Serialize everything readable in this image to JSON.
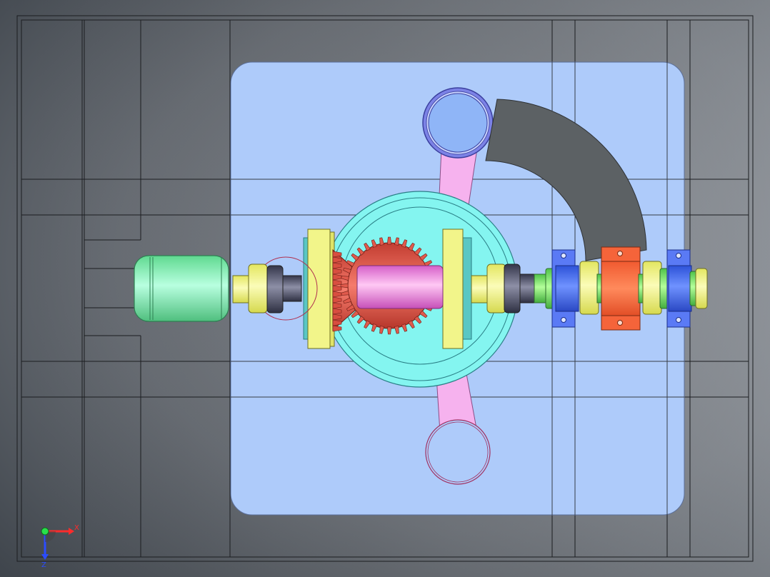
{
  "viewport": {
    "background_colors": [
      "#3f454d",
      "#8b9097",
      "#a9adb3"
    ],
    "frame_color": "#1b1d20"
  },
  "model": {
    "housing_color": "#aecbfa",
    "motor_color": "#7ef0b2",
    "bearing_color": "#f2f58a",
    "ring_gear_color": "#84f5f0",
    "bevel_gear_color": "#e05a4c",
    "shaft_color": "#ff8ee8",
    "pillow_block_color": "#f5643a",
    "mount_plate_color": "#3f6af2",
    "arm_color": "#f6b2ee",
    "sector_color": "#5c6164"
  },
  "triad": {
    "x_label": "X",
    "z_label": "Z",
    "x_color": "#ff2b2b",
    "z_color": "#2b4cff",
    "origin_color": "#29e04a"
  }
}
